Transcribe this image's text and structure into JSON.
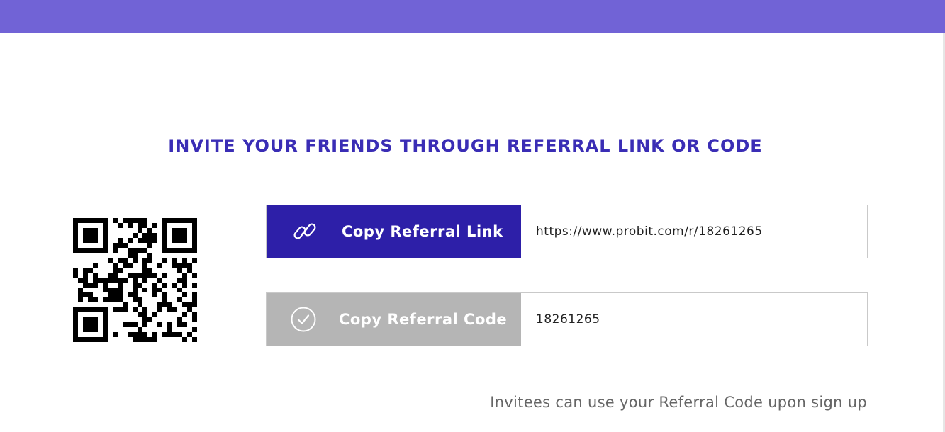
{
  "header": {
    "bar_color": "#7163d6"
  },
  "main": {
    "title": "INVITE YOUR FRIENDS THROUGH REFERRAL LINK OR CODE",
    "qr_code": {
      "icon": "qr-code-icon"
    },
    "link_row": {
      "button_label": "Copy Referral Link",
      "button_icon": "link-icon",
      "value": "https://www.probit.com/r/18261265",
      "accent": "#2d1fa8"
    },
    "code_row": {
      "button_label": "Copy Referral Code",
      "button_icon": "check-circle-icon",
      "value": "18261265"
    },
    "footnote": "Invitees can use your Referral Code upon sign up"
  }
}
